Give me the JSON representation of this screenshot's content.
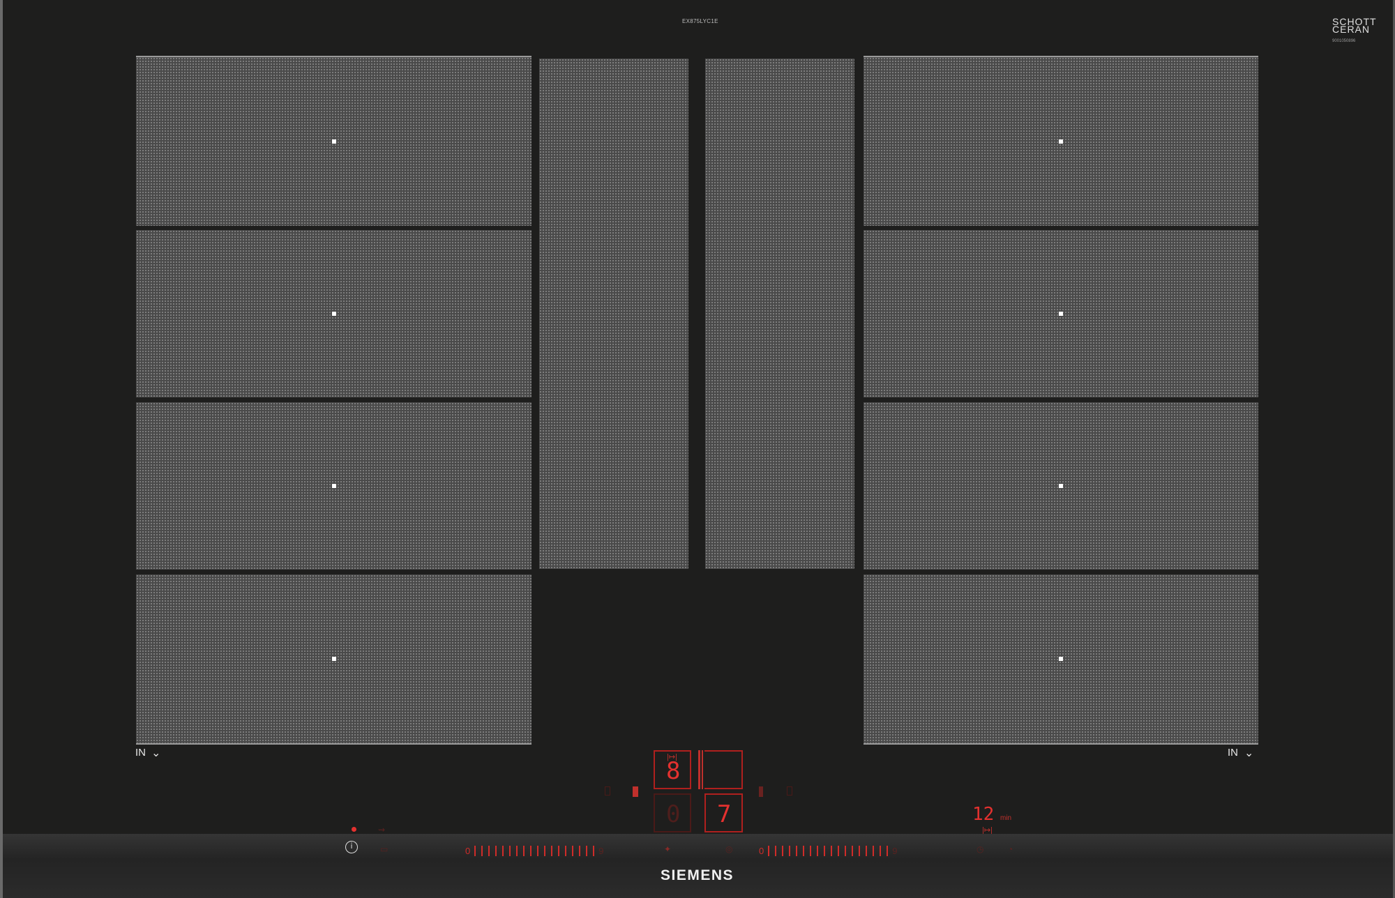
{
  "header": {
    "model": "EX875LYC1E",
    "glass_brand_line1": "SCHOTT",
    "glass_brand_line2": "CERAN",
    "glass_code": "9001050896"
  },
  "zones": {
    "left_labels": {
      "mode": "IN",
      "icon": "pan-detection-icon"
    },
    "right_labels": {
      "mode": "IN",
      "icon": "pan-detection-icon"
    }
  },
  "controls": {
    "display_top_left": "8",
    "display_bottom_left": "0",
    "display_bottom_right": "7",
    "timer_symbol": "|↦|",
    "timer_value": "12",
    "timer_unit": "min",
    "timer_symbol_2": "|↦|",
    "slider_left_start": "0",
    "slider_left_end": "9",
    "slider_right_start": "0",
    "slider_right_end": "9",
    "power_symbol": "ⓘ",
    "brand": "SIEMENS"
  },
  "colors": {
    "glass": "#1e1e1d",
    "zone_fill": "#4a4a4a",
    "indicator": "#e4312f"
  }
}
